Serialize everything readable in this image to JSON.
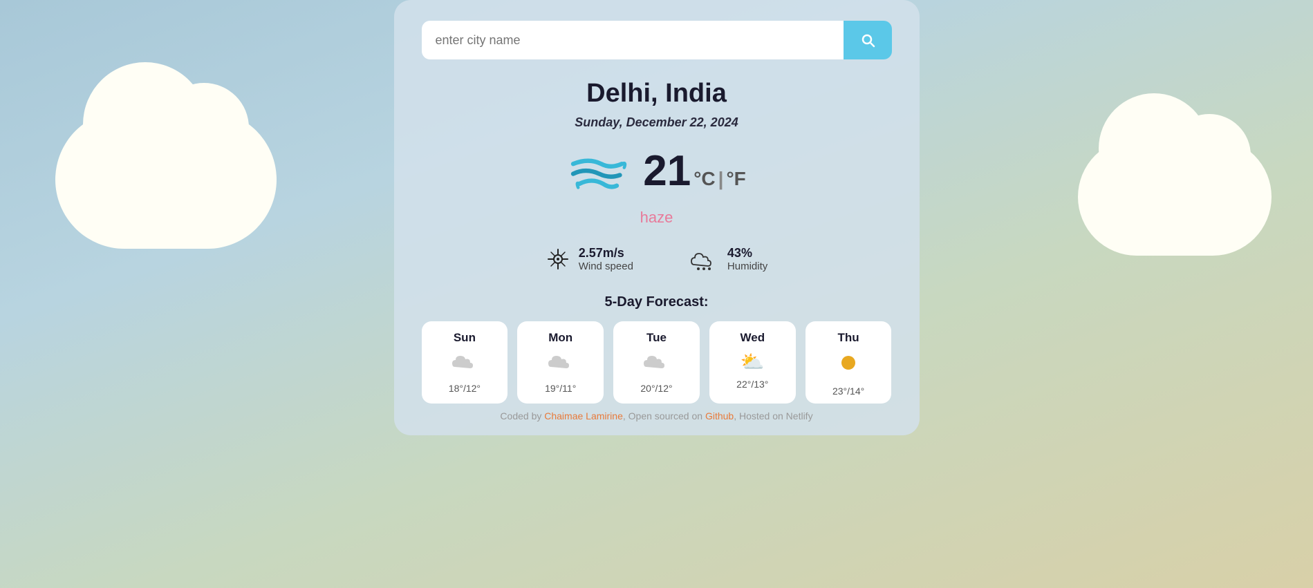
{
  "background": {
    "colors": [
      "#a8c8d8",
      "#b8d4e0",
      "#c8d8c0",
      "#d8d0a8"
    ]
  },
  "search": {
    "placeholder": "enter city name",
    "button_label": "search"
  },
  "weather": {
    "city": "Delhi, India",
    "date": "Sunday, December 22, 2024",
    "temperature_c": "21",
    "temperature_unit_c": "°C",
    "temperature_separator": "|",
    "temperature_unit_f": "°F",
    "description": "haze",
    "wind_speed_value": "2.57m/s",
    "wind_speed_label": "Wind speed",
    "humidity_value": "43%",
    "humidity_label": "Humidity"
  },
  "forecast": {
    "title": "5-Day Forecast:",
    "days": [
      {
        "day": "Sun",
        "icon": "☁",
        "temp": "18°/12°"
      },
      {
        "day": "Mon",
        "icon": "☁",
        "temp": "19°/11°"
      },
      {
        "day": "Tue",
        "icon": "☁",
        "temp": "20°/12°"
      },
      {
        "day": "Wed",
        "icon": "⛅",
        "temp": "22°/13°"
      },
      {
        "day": "Thu",
        "icon": "☀",
        "temp": "23°/14°"
      }
    ]
  },
  "footer": {
    "text_before": "Coded by ",
    "author": "Chaimae Lamirine",
    "text_middle": ", Open sourced on ",
    "github_label": "Github",
    "text_after": ", Hosted on Netlify"
  }
}
